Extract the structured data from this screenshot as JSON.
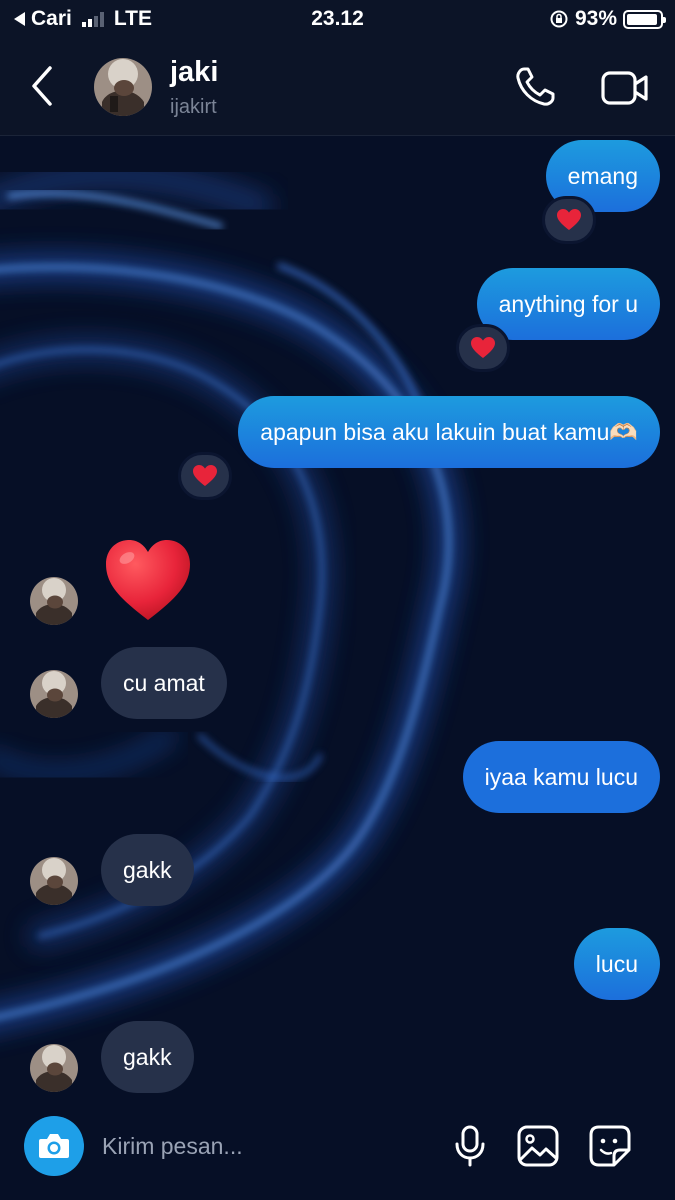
{
  "status_bar": {
    "back_app": "Cari",
    "network": "LTE",
    "signal_bars_active": 2,
    "time": "23.12",
    "battery_percent": "93%",
    "battery_level": 0.93
  },
  "header": {
    "name": "jaki",
    "username": "ijakirt",
    "icons": [
      "back-chevron-icon",
      "phone-icon",
      "video-camera-icon"
    ]
  },
  "messages": [
    {
      "id": "m1",
      "from": "me",
      "text": "emang",
      "reaction": "heart"
    },
    {
      "id": "m2",
      "from": "me",
      "text": "anything for u",
      "reaction": "heart"
    },
    {
      "id": "m3",
      "from": "me",
      "text": "apapun bisa aku lakuin buat kamu🫶🏻",
      "reaction": "heart"
    },
    {
      "id": "m4",
      "from": "them",
      "type": "emoji",
      "emoji": "heart"
    },
    {
      "id": "m5",
      "from": "them",
      "text": "cu amat"
    },
    {
      "id": "m6",
      "from": "me",
      "text": "iyaa kamu lucu"
    },
    {
      "id": "m7",
      "from": "them",
      "text": "gakk"
    },
    {
      "id": "m8",
      "from": "me",
      "text": "lucu"
    },
    {
      "id": "m9",
      "from": "them",
      "text": "gakk"
    }
  ],
  "composer": {
    "placeholder": "Kirim pesan...",
    "icons": [
      "camera-icon",
      "microphone-icon",
      "gallery-icon",
      "sticker-icon"
    ]
  },
  "colors": {
    "sent_bubble_top": "#1d9bde",
    "sent_bubble_bottom": "#1c6fdc",
    "received_bubble": "#26314a",
    "background": "#060f26",
    "heart": "#e8243a",
    "camera_button": "#1e9fe8"
  }
}
